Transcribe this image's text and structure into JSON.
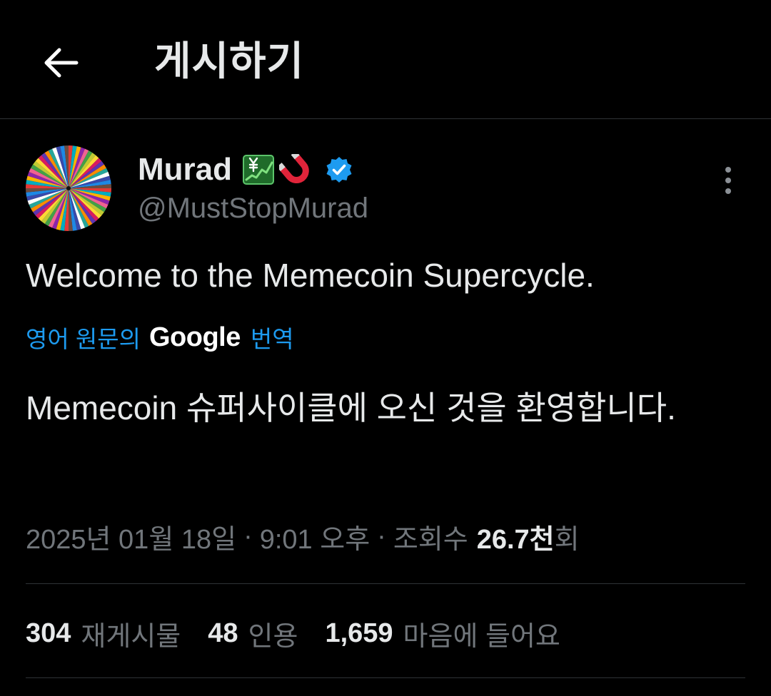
{
  "header": {
    "title": "게시하기",
    "back_icon": "arrow-left-icon"
  },
  "author": {
    "name": "Murad",
    "emojis": [
      "chart-yen-icon",
      "magnet-icon"
    ],
    "verified": true,
    "verified_color": "#1d9bf0",
    "handle": "@MustStopMurad",
    "avatar_icon": "color-burst-avatar"
  },
  "tweet": {
    "text": "Welcome to the Memecoin Supercycle.",
    "translation": {
      "pre_label": "영어 원문의",
      "brand": "Google",
      "post_label": "번역",
      "text": "Memecoin 슈퍼사이클에 오신 것을 환영합니다."
    }
  },
  "meta": {
    "date": "2025년 01월 18일",
    "separator": "·",
    "time": "9:01 오후",
    "views_label": "조회수",
    "views_number": "26.7천",
    "views_suffix": "회"
  },
  "stats": [
    {
      "number": "304",
      "label": "재게시물"
    },
    {
      "number": "48",
      "label": "인용"
    },
    {
      "number": "1,659",
      "label": "마음에 들어요"
    }
  ],
  "colors": {
    "background": "#000000",
    "text_primary": "#e7e9ea",
    "text_secondary": "#71767b",
    "link_blue": "#1d9bf0",
    "divider": "#2f3336"
  }
}
